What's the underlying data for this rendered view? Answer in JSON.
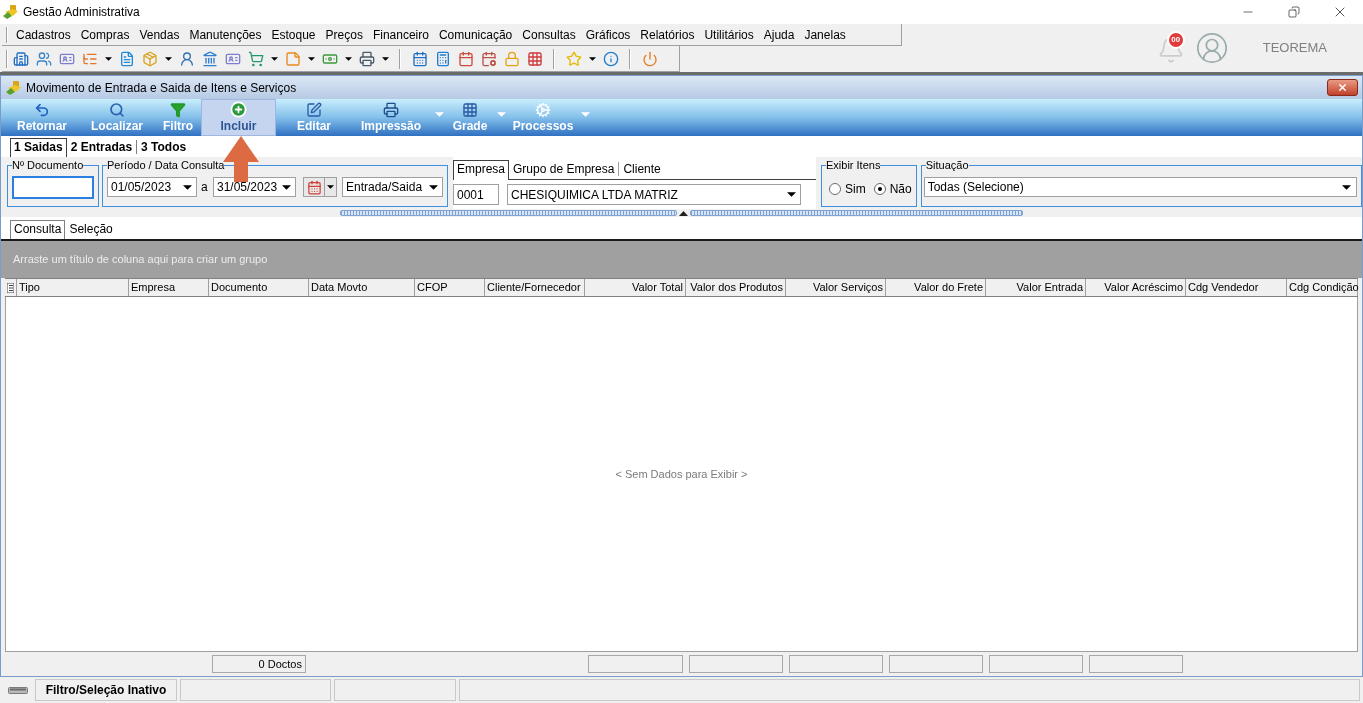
{
  "app": {
    "title": "Gestão Administrativa"
  },
  "menu": [
    "Cadastros",
    "Compras",
    "Vendas",
    "Manutenções",
    "Estoque",
    "Preços",
    "Financeiro",
    "Comunicação",
    "Consultas",
    "Gráficos",
    "Relatórios",
    "Utilitários",
    "Ajuda",
    "Janelas"
  ],
  "notifications": {
    "count": "00"
  },
  "user": {
    "name": "TEOREMA"
  },
  "form": {
    "title": "Movimento de Entrada e Saida de Itens e Serviços",
    "actions": [
      {
        "label": "Retornar",
        "highlighted": false,
        "dropdown": false
      },
      {
        "label": "Localizar",
        "highlighted": false,
        "dropdown": false
      },
      {
        "label": "Filtro",
        "highlighted": false,
        "dropdown": false
      },
      {
        "label": "Incluir",
        "highlighted": true,
        "dropdown": false
      },
      {
        "label": "Editar",
        "highlighted": false,
        "dropdown": false
      },
      {
        "label": "Impressão",
        "highlighted": false,
        "dropdown": true
      },
      {
        "label": "Grade",
        "highlighted": false,
        "dropdown": true
      },
      {
        "label": "Processos",
        "highlighted": false,
        "dropdown": true
      }
    ],
    "operation_tabs": [
      {
        "label": "1 Saidas",
        "selected": true
      },
      {
        "label": "2 Entradas",
        "selected": false
      },
      {
        "label": "3 Todos",
        "selected": false
      }
    ],
    "filters": {
      "document_number": {
        "label": "Nº Documento"
      },
      "period": {
        "label": "Período / Data Consulta",
        "from": "01/05/2023",
        "separator": "a",
        "to": "31/05/2023",
        "movement_type": "Entrada/Saida"
      },
      "entity_tabs": [
        {
          "label": "Empresa",
          "selected": true
        },
        {
          "label": "Grupo de Empresa",
          "selected": false
        },
        {
          "label": "Cliente",
          "selected": false
        }
      ],
      "company_code": "0001",
      "company_name": "CHESIQUIMICA LTDA MATRIZ",
      "show_items": {
        "label": "Exibir Itens",
        "options": [
          {
            "label": "Sim",
            "selected": false
          },
          {
            "label": "Não",
            "selected": true
          }
        ]
      },
      "status": {
        "label": "Situação",
        "value": "Todas (Selecione)"
      }
    },
    "view_tabs": [
      {
        "label": "Consulta",
        "selected": true
      },
      {
        "label": "Seleção",
        "selected": false
      }
    ],
    "grid": {
      "group_hint": "Arraste um título de coluna aqui para criar um grupo",
      "columns": [
        {
          "label": "Tipo",
          "kind": "text"
        },
        {
          "label": "Empresa",
          "kind": "text"
        },
        {
          "label": "Documento",
          "kind": "text",
          "footer": "0 Doctos"
        },
        {
          "label": "Data Movto",
          "kind": "text"
        },
        {
          "label": "CFOP",
          "kind": "text"
        },
        {
          "label": "Cliente/Fornecedor",
          "kind": "text"
        },
        {
          "label": "Valor Total",
          "kind": "number"
        },
        {
          "label": "Valor dos Produtos",
          "kind": "number"
        },
        {
          "label": "Valor Serviços",
          "kind": "number"
        },
        {
          "label": "Valor do Frete",
          "kind": "number"
        },
        {
          "label": "Valor Entrada",
          "kind": "number"
        },
        {
          "label": "Valor Acréscimo",
          "kind": "number"
        },
        {
          "label": "Cdg Vendedor",
          "kind": "text"
        },
        {
          "label": "Cdg Condição",
          "kind": "text"
        }
      ],
      "empty_message": "< Sem Dados para Exibir >"
    }
  },
  "status_bar": {
    "filter_state": "Filtro/Seleção Inativo"
  }
}
